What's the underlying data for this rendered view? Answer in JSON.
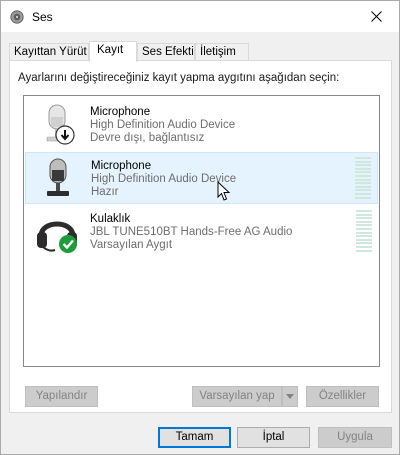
{
  "window": {
    "title": "Ses"
  },
  "tabs": [
    {
      "label": "Kayıttan Yürüt"
    },
    {
      "label": "Kayıt",
      "active": true
    },
    {
      "label": "Ses Efekti"
    },
    {
      "label": "İletişim"
    }
  ],
  "instruction": "Ayarlarını değiştireceğiniz kayıt yapma aygıtını aşağıdan seçin:",
  "devices": [
    {
      "name": "Microphone",
      "line2": "High Definition Audio Device",
      "line3": "Devre dışı, bağlantısız",
      "icon": "microphone-disconnected-icon",
      "selected": false
    },
    {
      "name": "Microphone",
      "line2": "High Definition Audio Device",
      "line3": "Hazır",
      "icon": "microphone-icon",
      "selected": true,
      "level": 0
    },
    {
      "name": "Kulaklık",
      "line2": "JBL TUNE510BT Hands-Free AG Audio",
      "line3": "Varsayılan Aygıt",
      "icon": "headset-default-icon",
      "selected": false,
      "level": 0
    }
  ],
  "buttons": {
    "configure": "Yapılandır",
    "set_default": "Varsayılan yap",
    "properties": "Özellikler",
    "ok": "Tamam",
    "cancel": "İptal",
    "apply": "Uygula"
  },
  "colors": {
    "accent": "#0078d7",
    "selection": "#e5f3ff",
    "check": "#1e9c3c"
  }
}
